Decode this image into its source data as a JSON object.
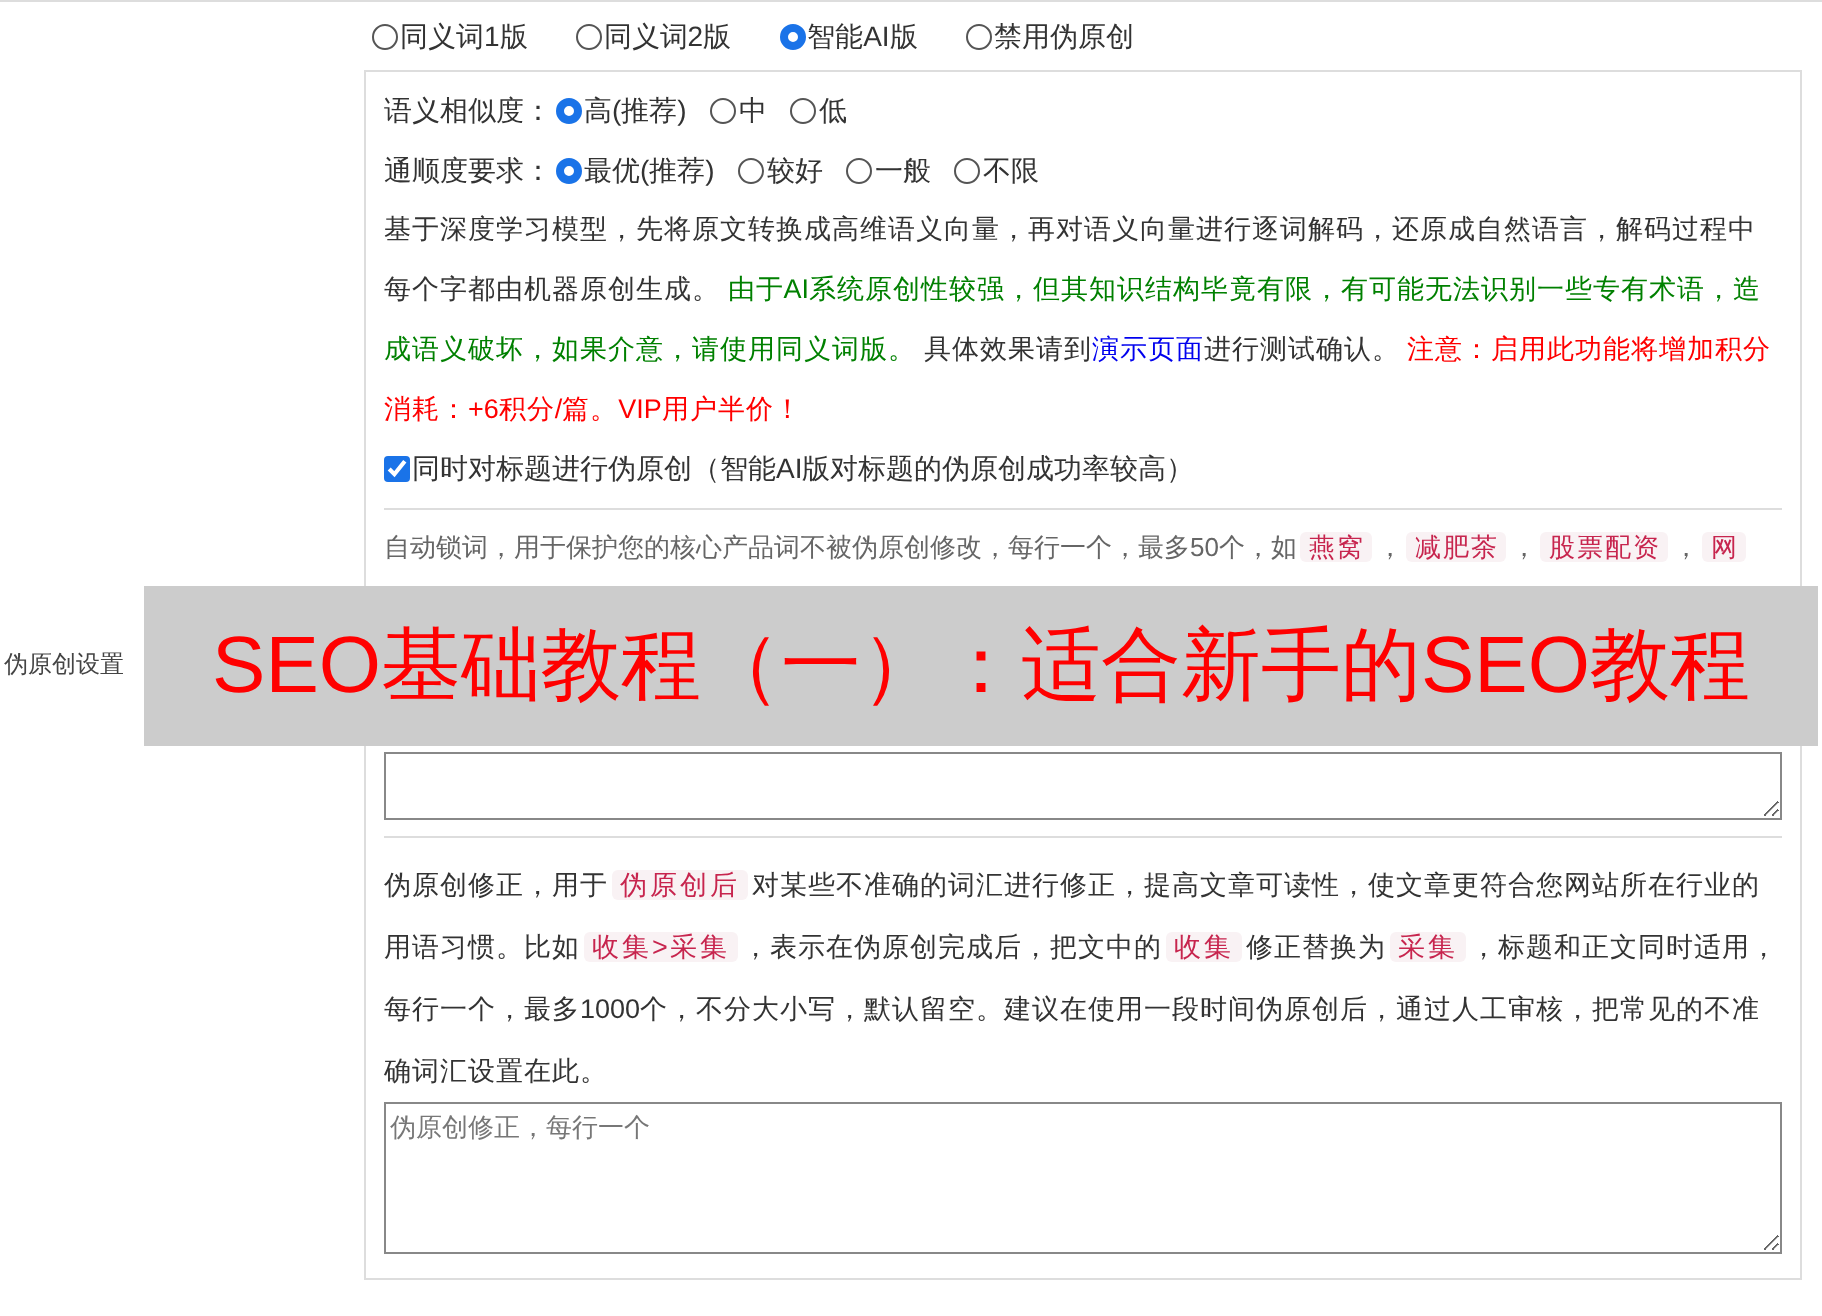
{
  "mode_options": [
    {
      "label": "同义词1版",
      "selected": false
    },
    {
      "label": "同义词2版",
      "selected": false
    },
    {
      "label": "智能AI版",
      "selected": true
    },
    {
      "label": "禁用伪原创",
      "selected": false
    }
  ],
  "section_label": "伪原创设置",
  "similarity": {
    "label": "语义相似度：",
    "options": [
      {
        "label": "高(推荐)",
        "selected": true
      },
      {
        "label": "中",
        "selected": false
      },
      {
        "label": "低",
        "selected": false
      }
    ]
  },
  "fluency": {
    "label": "通顺度要求：",
    "options": [
      {
        "label": "最优(推荐)",
        "selected": true
      },
      {
        "label": "较好",
        "selected": false
      },
      {
        "label": "一般",
        "selected": false
      },
      {
        "label": "不限",
        "selected": false
      }
    ]
  },
  "ai_description": [
    {
      "kind": "plain",
      "text": "基于深度学习模型，先将原文转换成高维语义向量，再对语义向量进行逐词解码，还原成自然语言，解码过程中每个字都由机器原创生成。 "
    },
    {
      "kind": "green",
      "text": "由于AI系统原创性较强，但其知识结构毕竟有限，有可能无法识别一些专有术语，造成语义破坏，如果介意，请使用同义词版。"
    },
    {
      "kind": "plain",
      "text": " 具体效果请到"
    },
    {
      "kind": "link",
      "text": "演示页面"
    },
    {
      "kind": "plain",
      "text": "进行测试确认。 "
    },
    {
      "kind": "red",
      "text": "注意：启用此功能将增加积分消耗：+6积分/篇。VIP用户半价！"
    }
  ],
  "title_option": {
    "label": "同时对标题进行伪原创（智能AI版对标题的伪原创成功率较高）",
    "checked": true
  },
  "lock_words": {
    "description": [
      {
        "kind": "plain",
        "text": "自动锁词，用于保护您的核心产品词不被伪原创修改，每行一个，最多50个，如"
      },
      {
        "kind": "code",
        "text": "燕窝"
      },
      {
        "kind": "plain",
        "text": "，"
      },
      {
        "kind": "code",
        "text": "减肥茶"
      },
      {
        "kind": "plain",
        "text": "，"
      },
      {
        "kind": "code",
        "text": "股票配资"
      },
      {
        "kind": "plain",
        "text": "，"
      },
      {
        "kind": "code",
        "text": "网"
      }
    ]
  },
  "correction": {
    "description": [
      {
        "kind": "plain",
        "text": "伪原创修正，用于"
      },
      {
        "kind": "code",
        "text": "伪原创后"
      },
      {
        "kind": "plain",
        "text": "对某些不准确的词汇进行修正，提高文章可读性，使文章更符合您网站所在行业的用语习惯。比如"
      },
      {
        "kind": "code",
        "text": "收集>采集"
      },
      {
        "kind": "plain",
        "text": "，表示在伪原创完成后，把文中的"
      },
      {
        "kind": "code",
        "text": "收集"
      },
      {
        "kind": "plain",
        "text": "修正替换为"
      },
      {
        "kind": "code",
        "text": "采集"
      },
      {
        "kind": "plain",
        "text": "，标题和正文同时适用，每行一个，最多1000个，不分大小写，默认留空。建议在使用一段时间伪原创后，通过人工审核，把常见的不准确词汇设置在此。"
      }
    ],
    "placeholder": "伪原创修正，每行一个"
  },
  "banner": {
    "text": "SEO基础教程（一）：适合新手的SEO教程"
  }
}
